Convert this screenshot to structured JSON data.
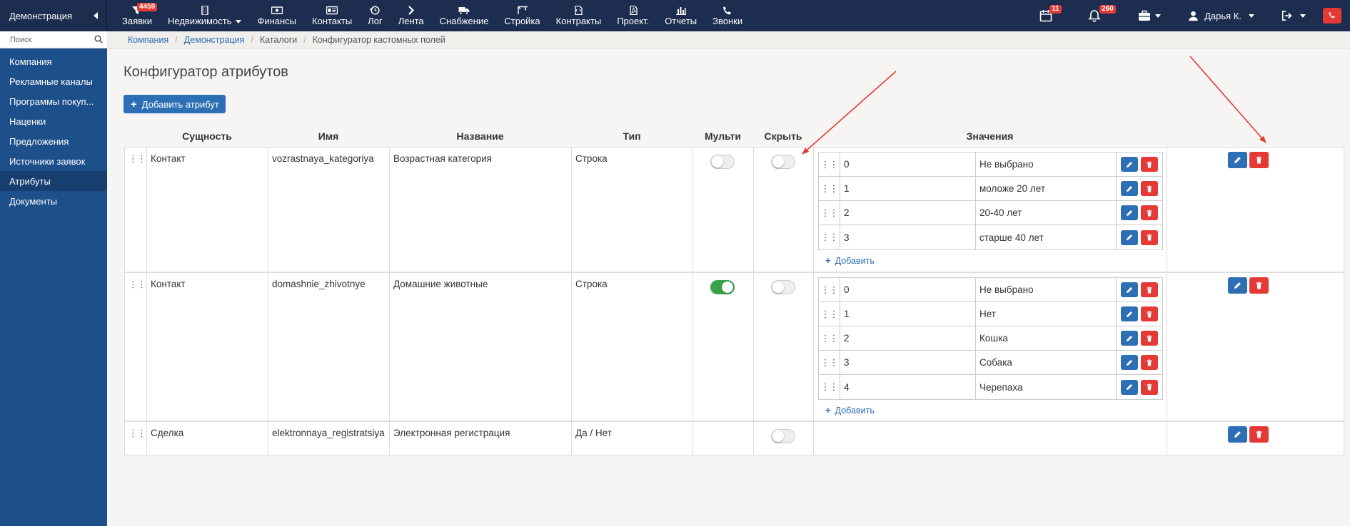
{
  "topbar": {
    "brand": "Демонстрация",
    "nav": [
      {
        "label": "Заявки",
        "icon": "funnel-icon",
        "badge": "4459"
      },
      {
        "label": "Недвижимость",
        "icon": "building-icon",
        "dropdown": true
      },
      {
        "label": "Финансы",
        "icon": "money-icon"
      },
      {
        "label": "Контакты",
        "icon": "id-card-icon"
      },
      {
        "label": "Лог",
        "icon": "history-icon"
      },
      {
        "label": "Лента",
        "icon": "chevron-right-icon"
      },
      {
        "label": "Снабжение",
        "icon": "truck-icon"
      },
      {
        "label": "Стройка",
        "icon": "crane-icon"
      },
      {
        "label": "Контракты",
        "icon": "document-icon"
      },
      {
        "label": "Проект.",
        "icon": "pdf-icon"
      },
      {
        "label": "Отчеты",
        "icon": "bar-chart-icon"
      },
      {
        "label": "Звонки",
        "icon": "phone-icon"
      }
    ],
    "calendar_badge": "11",
    "bell_badge": "260",
    "user_name": "Дарья К."
  },
  "sidebar": {
    "search_placeholder": "Поиск",
    "items": [
      {
        "label": "Компания"
      },
      {
        "label": "Рекламные каналы"
      },
      {
        "label": "Программы покуп..."
      },
      {
        "label": "Наценки"
      },
      {
        "label": "Предложения"
      },
      {
        "label": "Источники заявок"
      },
      {
        "label": "Атрибуты",
        "active": true
      },
      {
        "label": "Документы"
      }
    ]
  },
  "breadcrumb": [
    "Компания",
    "Демонстрация",
    "Каталоги",
    "Конфигуратор кастомных полей"
  ],
  "page": {
    "title": "Конфигуратор атрибутов",
    "add_button": "Добавить атрибут"
  },
  "table": {
    "headers": {
      "entity": "Сущность",
      "name": "Имя",
      "title": "Название",
      "type": "Тип",
      "multi": "Мульти",
      "hide": "Скрыть",
      "values": "Значения"
    },
    "add_value_label": "Добавить",
    "rows": [
      {
        "entity": "Контакт",
        "name": "vozrastnaya_kategoriya",
        "title": "Возрастная категория",
        "type": "Строка",
        "multi": false,
        "hide": false,
        "values": [
          {
            "key": "0",
            "label": "Не выбрано"
          },
          {
            "key": "1",
            "label": "моложе 20 лет"
          },
          {
            "key": "2",
            "label": "20-40 лет"
          },
          {
            "key": "3",
            "label": "старше 40 лет"
          }
        ]
      },
      {
        "entity": "Контакт",
        "name": "domashnie_zhivotnye",
        "title": "Домашние животные",
        "type": "Строка",
        "multi": true,
        "hide": false,
        "values": [
          {
            "key": "0",
            "label": "Не выбрано"
          },
          {
            "key": "1",
            "label": "Нет"
          },
          {
            "key": "2",
            "label": "Кошка"
          },
          {
            "key": "3",
            "label": "Собака"
          },
          {
            "key": "4",
            "label": "Черепаха"
          }
        ]
      },
      {
        "entity": "Сделка",
        "name": "elektronnaya_registratsiya",
        "title": "Электронная регистрация",
        "type": "Да / Нет",
        "hide": false
      }
    ]
  },
  "colors": {
    "topbar": "#1c2d4f",
    "sidebar": "#1d4f8b",
    "primary": "#2d6fb5",
    "danger": "#e53935",
    "toggle_on": "#3aa34a",
    "annotation_arrow": "#e53935"
  }
}
